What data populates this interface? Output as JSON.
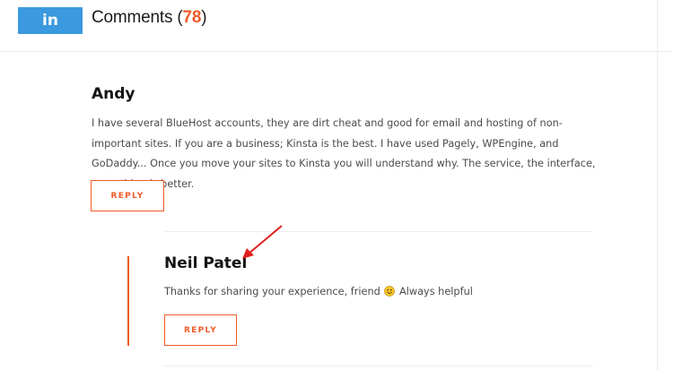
{
  "header": {
    "share_button_label": "in",
    "comments_label": "Comments",
    "comments_count": "78"
  },
  "comments": [
    {
      "author": "Andy",
      "text": "I have several BlueHost accounts, they are dirt cheat and good for email and hosting of non-important sites. If you are a business; Kinsta is the best. I have used Pagely, WPEngine, and GoDaddy... Once you move your sites to Kinsta you will understand why. The service, the interface, everything is better.",
      "reply_label": "REPLY"
    },
    {
      "author": "Neil Patel",
      "text_before": "Thanks for sharing your experience, friend",
      "text_after": "Always helpful",
      "reply_label": "REPLY"
    }
  ],
  "colors": {
    "accent": "#ef5a27",
    "linkedin": "#3b99e0",
    "annotation_arrow": "#e02020"
  },
  "icons": [
    "linkedin-icon",
    "smiley-emoji-icon",
    "arrow-annotation-icon"
  ]
}
